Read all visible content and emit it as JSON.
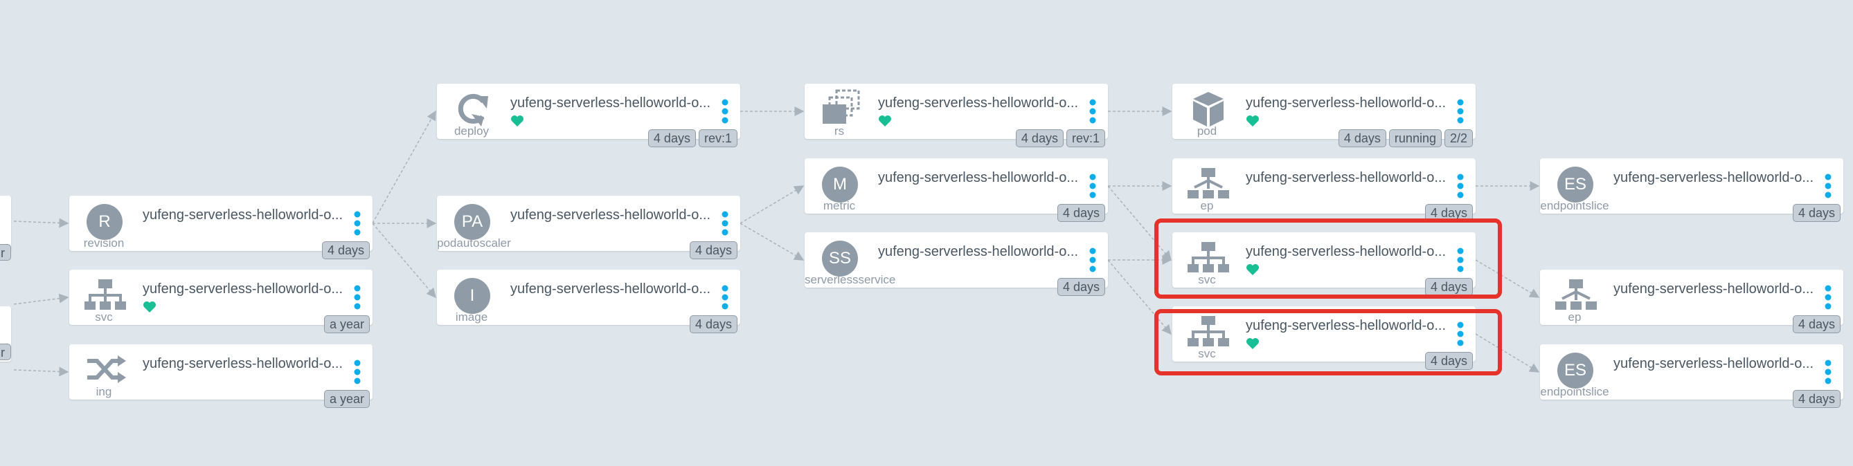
{
  "colors": {
    "background": "#dee6eb",
    "card": "#ffffff",
    "icon_gray": "#8f9ba6",
    "health_green": "#18be94",
    "menu_teal": "#0dadea",
    "highlight_red": "#e5322b",
    "edge_gray": "#a9b3bc"
  },
  "partial_tags": [
    "r",
    "r"
  ],
  "nodes": [
    {
      "id": "revision",
      "kind": "revision",
      "icon": "circle-letter-icon",
      "letter": "R",
      "name": "yufeng-serverless-helloworld-o...",
      "healthy": false,
      "tags": [
        "4 days"
      ]
    },
    {
      "id": "svc1",
      "kind": "svc",
      "icon": "service-tree-icon",
      "name": "yufeng-serverless-helloworld-o...",
      "healthy": true,
      "tags": [
        "a year"
      ]
    },
    {
      "id": "ing",
      "kind": "ing",
      "icon": "shuffle-icon",
      "name": "yufeng-serverless-helloworld-o...",
      "healthy": false,
      "tags": [
        "a year"
      ]
    },
    {
      "id": "deploy",
      "kind": "deploy",
      "icon": "deploy-refresh-icon",
      "name": "yufeng-serverless-helloworld-o...",
      "healthy": true,
      "tags": [
        "4 days",
        "rev:1"
      ]
    },
    {
      "id": "podautoscaler",
      "kind": "podautoscaler",
      "icon": "circle-letter-icon",
      "letter": "PA",
      "name": "yufeng-serverless-helloworld-o...",
      "healthy": false,
      "tags": [
        "4 days"
      ]
    },
    {
      "id": "image",
      "kind": "image",
      "icon": "circle-letter-icon",
      "letter": "I",
      "name": "yufeng-serverless-helloworld-o...",
      "healthy": false,
      "tags": [
        "4 days"
      ]
    },
    {
      "id": "rs",
      "kind": "rs",
      "icon": "replicaset-stack-icon",
      "name": "yufeng-serverless-helloworld-o...",
      "healthy": true,
      "tags": [
        "4 days",
        "rev:1"
      ]
    },
    {
      "id": "metric",
      "kind": "metric",
      "icon": "circle-letter-icon",
      "letter": "M",
      "name": "yufeng-serverless-helloworld-o...",
      "healthy": false,
      "tags": [
        "4 days"
      ]
    },
    {
      "id": "serverlessservice",
      "kind": "serverlessservice",
      "icon": "circle-letter-icon",
      "letter": "SS",
      "name": "yufeng-serverless-helloworld-o...",
      "healthy": false,
      "tags": [
        "4 days"
      ]
    },
    {
      "id": "pod",
      "kind": "pod",
      "icon": "pod-cube-icon",
      "name": "yufeng-serverless-helloworld-o...",
      "healthy": true,
      "tags": [
        "4 days",
        "running",
        "2/2"
      ]
    },
    {
      "id": "ep1",
      "kind": "ep",
      "icon": "endpoints-tree-icon",
      "name": "yufeng-serverless-helloworld-o...",
      "healthy": false,
      "tags": [
        "4 days"
      ]
    },
    {
      "id": "svc2",
      "kind": "svc",
      "icon": "service-tree-icon",
      "name": "yufeng-serverless-helloworld-o...",
      "healthy": true,
      "tags": [
        "4 days"
      ]
    },
    {
      "id": "svc3",
      "kind": "svc",
      "icon": "service-tree-icon",
      "name": "yufeng-serverless-helloworld-o...",
      "healthy": true,
      "tags": [
        "4 days"
      ]
    },
    {
      "id": "es1",
      "kind": "endpointslice",
      "icon": "circle-letter-icon",
      "letter": "ES",
      "name": "yufeng-serverless-helloworld-o...",
      "healthy": false,
      "tags": [
        "4 days"
      ]
    },
    {
      "id": "ep2",
      "kind": "ep",
      "icon": "endpoints-tree-icon",
      "name": "yufeng-serverless-helloworld-o...",
      "healthy": false,
      "tags": [
        "4 days"
      ]
    },
    {
      "id": "es2",
      "kind": "endpointslice",
      "icon": "circle-letter-icon",
      "letter": "ES",
      "name": "yufeng-serverless-helloworld-o...",
      "healthy": false,
      "tags": [
        "4 days"
      ]
    }
  ]
}
